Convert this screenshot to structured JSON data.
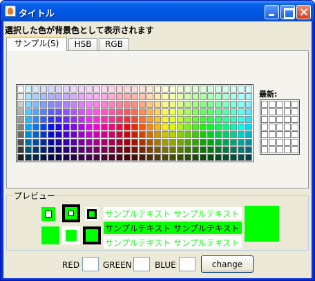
{
  "window": {
    "title": "タイトル"
  },
  "instruction": "選択した色が背景色として表示されます",
  "tabs": [
    {
      "label": "サンプル(S)",
      "active": true
    },
    {
      "label": "HSB",
      "active": false
    },
    {
      "label": "RGB",
      "active": false
    }
  ],
  "swatches": {
    "recent_label": "最新:"
  },
  "preview": {
    "legend": "プレビュー",
    "sample_text": "サンプルテキスト サンプルテキスト",
    "color": "#00ff00"
  },
  "bottom": {
    "red_label": "RED",
    "green_label": "GREEN",
    "blue_label": "BLUE",
    "red_value": "",
    "green_value": "",
    "blue_value": "",
    "change_label": "change"
  }
}
